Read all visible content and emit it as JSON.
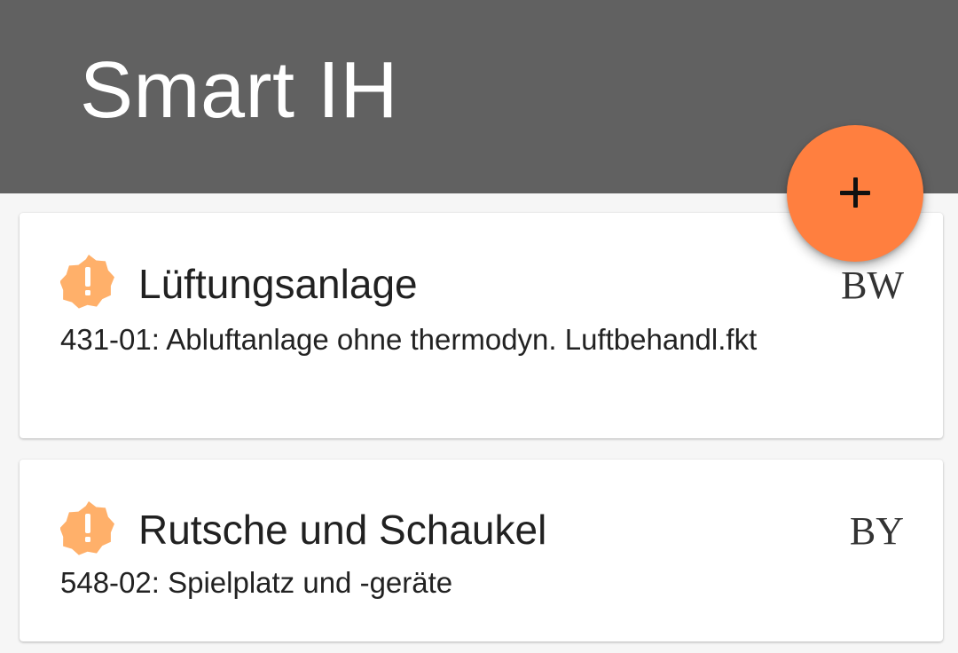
{
  "app": {
    "title": "Smart IH"
  },
  "fab": {
    "icon": "plus-icon",
    "color": "#ff7f3f"
  },
  "colors": {
    "app_bar": "#616161",
    "warning_icon": "#ffb06a",
    "background": "#f6f6f6"
  },
  "cards": [
    {
      "icon": "warning-badge-icon",
      "title": "Lüftungsanlage",
      "code": "BW",
      "subtitle": "431-01: Abluftanlage ohne thermodyn. Luftbehandl.fkt"
    },
    {
      "icon": "warning-badge-icon",
      "title": "Rutsche und Schaukel",
      "code": "BY",
      "subtitle": "548-02: Spielplatz und -geräte"
    }
  ]
}
